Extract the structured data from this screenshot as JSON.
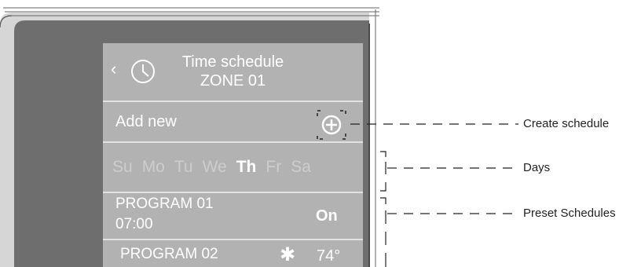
{
  "header": {
    "title_line1": "Time schedule",
    "title_line2": "ZONE 01",
    "back_icon": "chevron-left-icon",
    "clock_icon": "clock-icon"
  },
  "add_new": {
    "label": "Add new",
    "icon": "plus-circle-icon"
  },
  "days": [
    {
      "label": "Su",
      "active": false
    },
    {
      "label": "Mo",
      "active": false
    },
    {
      "label": "Tu",
      "active": false
    },
    {
      "label": "We",
      "active": false
    },
    {
      "label": "Th",
      "active": true
    },
    {
      "label": "Fr",
      "active": false
    },
    {
      "label": "Sa",
      "active": false
    }
  ],
  "programs": [
    {
      "name": "PROGRAM 01",
      "time": "07:00",
      "state": "On"
    },
    {
      "name": "PROGRAM 02",
      "mode_icon": "snowflake-icon",
      "temp": "74°"
    }
  ],
  "callouts": {
    "create": "Create schedule",
    "days": "Days",
    "presets": "Preset Schedules"
  },
  "colors": {
    "screen": "#b2b2b2",
    "bezel": "#6e6e6e",
    "text": "#ffffff",
    "inactive_day": "#cdcdcd"
  }
}
